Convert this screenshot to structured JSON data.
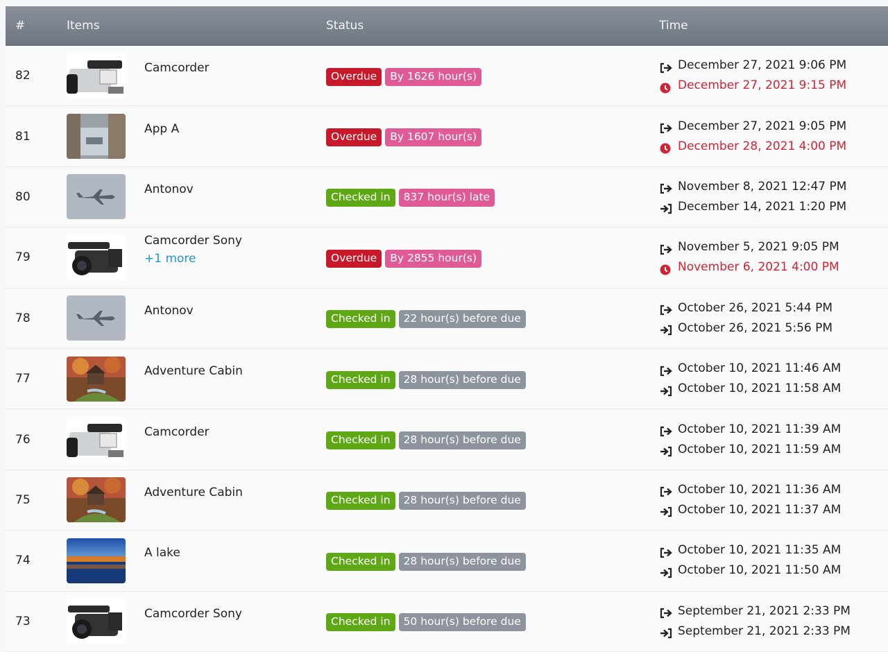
{
  "table": {
    "headers": {
      "num": "#",
      "items": "Items",
      "status": "Status",
      "time": "Time"
    },
    "rows": [
      {
        "num": "82",
        "thumb": "camcorder-silver",
        "item": "Camcorder",
        "more": null,
        "status": "Overdue",
        "status_color": "#c8192b",
        "detail": "By 1626 hour(s)",
        "detail_color": "#e05a96",
        "time_out": "December 27, 2021 9:06 PM",
        "time_in": "December 27, 2021 9:15 PM",
        "time_in_icon": "clock-icon",
        "time_in_overdue": true
      },
      {
        "num": "81",
        "thumb": "app-photo",
        "item": "App A",
        "more": null,
        "status": "Overdue",
        "status_color": "#c8192b",
        "detail": "By 1607 hour(s)",
        "detail_color": "#e05a96",
        "time_out": "December 27, 2021 9:05 PM",
        "time_in": "December 28, 2021 4:00 PM",
        "time_in_icon": "clock-icon",
        "time_in_overdue": true
      },
      {
        "num": "80",
        "thumb": "airplane",
        "item": "Antonov",
        "more": null,
        "status": "Checked in",
        "status_color": "#5ea715",
        "detail": "837 hour(s) late",
        "detail_color": "#e05a96",
        "time_out": "November 8, 2021 12:47 PM",
        "time_in": "December 14, 2021 1:20 PM",
        "time_in_icon": "sign-in-icon",
        "time_in_overdue": false
      },
      {
        "num": "79",
        "thumb": "camcorder-black",
        "item": "Camcorder Sony",
        "more": "+1 more",
        "status": "Overdue",
        "status_color": "#c8192b",
        "detail": "By 2855 hour(s)",
        "detail_color": "#e05a96",
        "time_out": "November 5, 2021 9:05 PM",
        "time_in": "November 6, 2021 4:00 PM",
        "time_in_icon": "clock-icon",
        "time_in_overdue": true
      },
      {
        "num": "78",
        "thumb": "airplane",
        "item": "Antonov",
        "more": null,
        "status": "Checked in",
        "status_color": "#5ea715",
        "detail": "22 hour(s) before due",
        "detail_color": "#8d949d",
        "time_out": "October 26, 2021 5:44 PM",
        "time_in": "October 26, 2021 5:56 PM",
        "time_in_icon": "sign-in-icon",
        "time_in_overdue": false
      },
      {
        "num": "77",
        "thumb": "cabin",
        "item": "Adventure Cabin",
        "more": null,
        "status": "Checked in",
        "status_color": "#5ea715",
        "detail": "28 hour(s) before due",
        "detail_color": "#8d949d",
        "time_out": "October 10, 2021 11:46 AM",
        "time_in": "October 10, 2021 11:58 AM",
        "time_in_icon": "sign-in-icon",
        "time_in_overdue": false
      },
      {
        "num": "76",
        "thumb": "camcorder-silver",
        "item": "Camcorder",
        "more": null,
        "status": "Checked in",
        "status_color": "#5ea715",
        "detail": "28 hour(s) before due",
        "detail_color": "#8d949d",
        "time_out": "October 10, 2021 11:39 AM",
        "time_in": "October 10, 2021 11:59 AM",
        "time_in_icon": "sign-in-icon",
        "time_in_overdue": false
      },
      {
        "num": "75",
        "thumb": "cabin",
        "item": "Adventure Cabin",
        "more": null,
        "status": "Checked in",
        "status_color": "#5ea715",
        "detail": "28 hour(s) before due",
        "detail_color": "#8d949d",
        "time_out": "October 10, 2021 11:36 AM",
        "time_in": "October 10, 2021 11:37 AM",
        "time_in_icon": "sign-in-icon",
        "time_in_overdue": false
      },
      {
        "num": "74",
        "thumb": "lake",
        "item": "A lake",
        "more": null,
        "status": "Checked in",
        "status_color": "#5ea715",
        "detail": "28 hour(s) before due",
        "detail_color": "#8d949d",
        "time_out": "October 10, 2021 11:35 AM",
        "time_in": "October 10, 2021 11:50 AM",
        "time_in_icon": "sign-in-icon",
        "time_in_overdue": false
      },
      {
        "num": "73",
        "thumb": "camcorder-black",
        "item": "Camcorder Sony",
        "more": null,
        "status": "Checked in",
        "status_color": "#5ea715",
        "detail": "50 hour(s) before due",
        "detail_color": "#8d949d",
        "time_out": "September 21, 2021 2:33 PM",
        "time_in": "September 21, 2021 2:33 PM",
        "time_in_icon": "sign-in-icon",
        "time_in_overdue": false
      }
    ]
  }
}
